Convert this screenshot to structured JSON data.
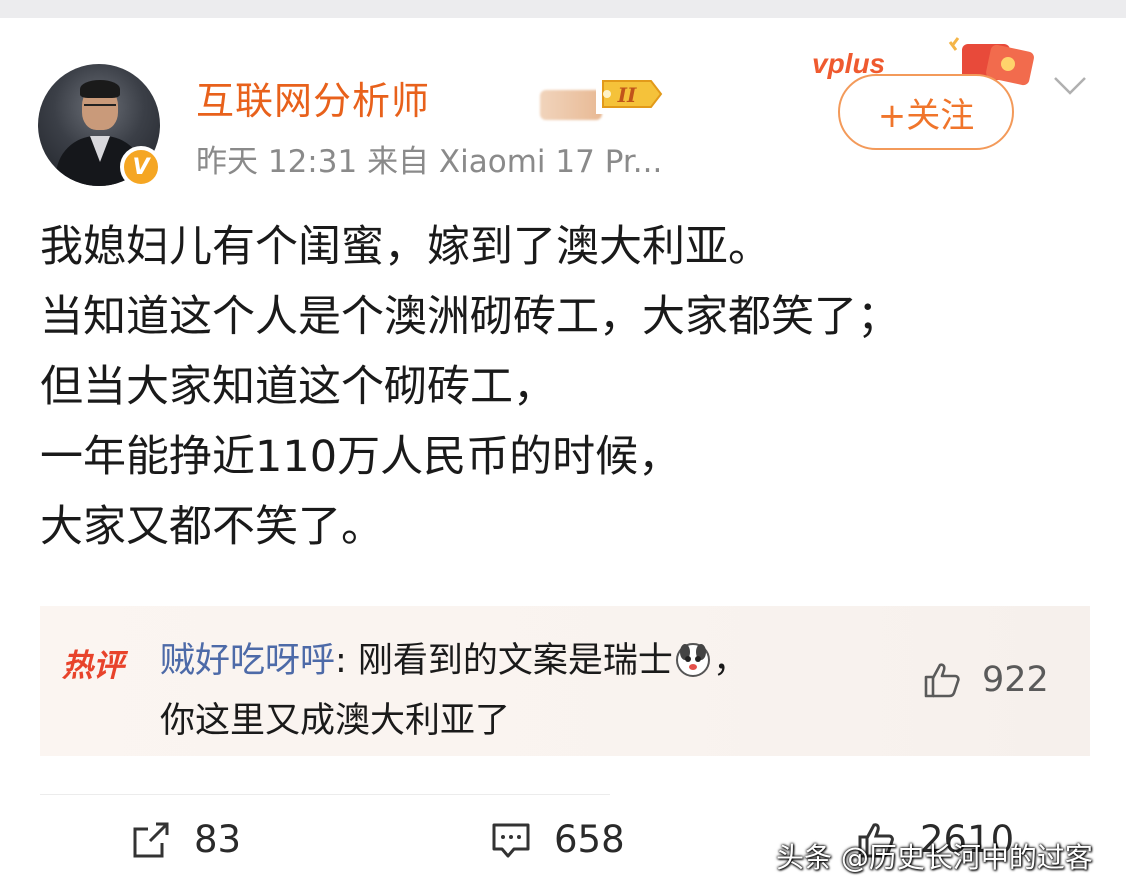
{
  "author": {
    "name": "互联网分析师",
    "time": "昨天 12:31",
    "source": "来自 Xiaomi 17 Pr...",
    "level_badge": "II"
  },
  "header": {
    "vplus_label": "vplus",
    "follow_label": "+关注"
  },
  "post": {
    "lines": [
      "我媳妇儿有个闺蜜，嫁到了澳大利亚。",
      "当知道这个人是个澳洲砌砖工，大家都笑了；",
      "但当大家知道这个砌砖工，",
      "一年能挣近110万人民币的时候，",
      "大家又都不笑了。"
    ]
  },
  "hot_comment": {
    "badge": "热评",
    "user": "贼好吃呀呼",
    "text_line1": ": 刚看到的文案是瑞士",
    "text_line1_end": "，",
    "text_line2": "你这里又成澳大利亚了",
    "likes": "922"
  },
  "actions": {
    "repost_count": "83",
    "comment_count": "658",
    "like_count": "2610"
  },
  "watermark": "头条 @历史长河中的过客",
  "colors": {
    "username": "#e8611b",
    "follow": "#f0752b",
    "hot_badge": "#e8432b",
    "comment_user": "#4d6aa8"
  }
}
